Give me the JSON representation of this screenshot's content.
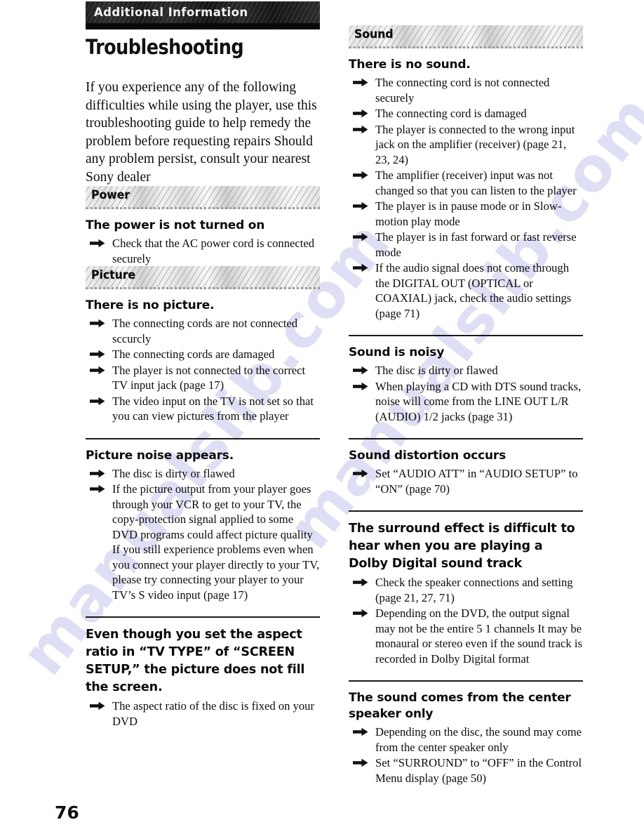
{
  "page": {
    "number": "76",
    "chapter_band_label": "Additional Information",
    "title": "Troubleshooting",
    "intro": "If you experience any of the following difficulties while using the player, use this troubleshooting guide to help remedy the problem before requesting repairs  Should any problem persist, consult your nearest Sony dealer",
    "colors": {
      "band_background": "#1a1a1a",
      "band_text": "#f2f2f2",
      "section_banner_background": "#e8e8e8",
      "body_text": "#0d0d0d",
      "watermark": "#6b6bd0"
    },
    "watermark_text": "manualslib.com"
  },
  "left_column": {
    "sections": [
      {
        "banner": "Power",
        "problems": [
          {
            "heading": "The power is not turned on",
            "solutions": [
              "Check that the AC power cord is connected securely"
            ],
            "divider_after": false
          }
        ]
      },
      {
        "banner": "Picture",
        "problems": [
          {
            "heading": "There is no picture.",
            "solutions": [
              "The connecting cords are not connected sccurcly",
              "The connecting cords are damaged",
              "The player is not connected to the correct TV input jack (page 17)",
              "The video input on the TV is not set so that you can view pictures from the player"
            ],
            "divider_after": true
          },
          {
            "heading": "Picture noise appears.",
            "solutions": [
              "The disc is dirty or flawed",
              "If the picture output from your player goes through your VCR to get to your TV, the copy-protection signal applied to some DVD programs could affect picture quality  If you still experience problems even when you connect your player directly to your TV, please try connecting your player to your TV’s S video input (page 17)"
            ],
            "divider_after": true
          },
          {
            "heading": "Even though you set the aspect ratio in “TV TYPE” of “SCREEN SETUP,” the picture does not fill the screen.",
            "solutions": [
              "The aspect ratio of the disc is fixed on your DVD"
            ],
            "divider_after": false
          }
        ]
      }
    ]
  },
  "right_column": {
    "sections": [
      {
        "banner": "Sound",
        "problems": [
          {
            "heading": "There is no sound.",
            "solutions": [
              "The connecting cord is not connected securely",
              "The connecting cord is damaged",
              "The player is connected to the wrong input jack on the amplifier (receiver) (page 21, 23, 24)",
              "The amplifier (receiver) input was not changed so that you can listen to the player",
              "The player is in pause mode or in Slow-motion play mode",
              "The player is in fast forward or fast reverse mode",
              "If the audio signal does not come through the DIGITAL OUT (OPTICAL or COAXIAL) jack, check the audio settings (page 71)"
            ],
            "divider_after": true
          },
          {
            "heading": "Sound is noisy",
            "solutions": [
              "The disc is dirty or flawed",
              "When playing a CD with DTS sound tracks, noise will come from the LINE OUT L/R (AUDIO) 1/2 jacks (page 31)"
            ],
            "divider_after": true
          },
          {
            "heading": "Sound distortion occurs",
            "solutions": [
              "Set “AUDIO ATT” in “AUDIO SETUP” to “ON” (page 70)"
            ],
            "divider_after": true
          },
          {
            "heading": "The surround effect is difficult to hear when you are playing a Dolby Digital sound track",
            "solutions": [
              "Check the speaker connections and setting (page 21, 27, 71)",
              "Depending on the DVD, the output signal may not be the entire 5 1 channels  It may be monaural or stereo even if the sound track is recorded in Dolby Digital format"
            ],
            "divider_after": true
          },
          {
            "heading": "The sound comes from the center speaker only",
            "solutions": [
              "Depending on the disc, the sound may come from the center speaker only",
              "Set “SURROUND” to “OFF” in the Control Menu display (page 50)"
            ],
            "divider_after": false
          }
        ]
      }
    ]
  }
}
